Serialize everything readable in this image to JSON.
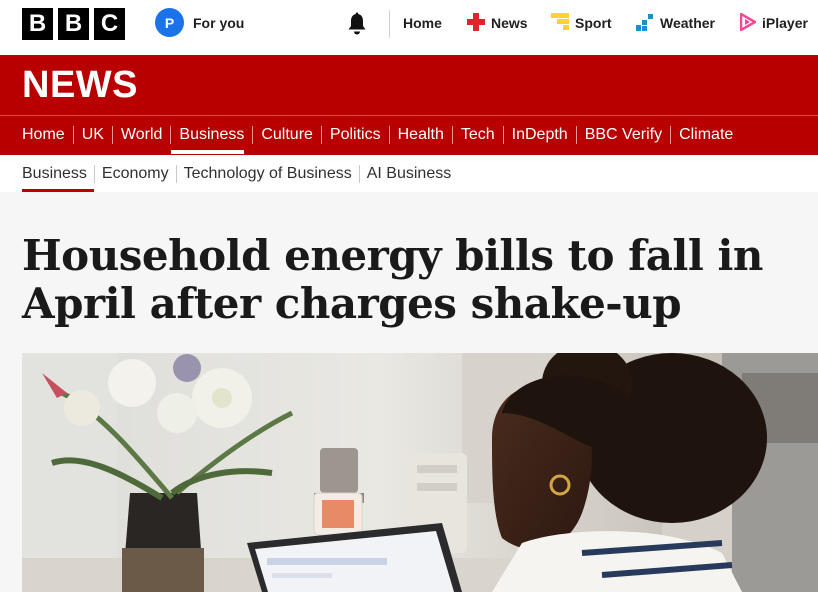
{
  "brand": {
    "letters": [
      "B",
      "B",
      "C"
    ]
  },
  "account": {
    "initial": "P",
    "label": "For you"
  },
  "top_nav": [
    {
      "label": "Home",
      "icon": "none"
    },
    {
      "label": "News",
      "icon": "news-icon"
    },
    {
      "label": "Sport",
      "icon": "sport-icon"
    },
    {
      "label": "Weather",
      "icon": "weather-icon"
    },
    {
      "label": "iPlayer",
      "icon": "iplayer-icon"
    }
  ],
  "section_title": "NEWS",
  "main_nav": [
    "Home",
    "UK",
    "World",
    "Business",
    "Culture",
    "Politics",
    "Health",
    "Tech",
    "InDepth",
    "BBC Verify",
    "Climate"
  ],
  "main_nav_active": "Business",
  "sub_nav": [
    "Business",
    "Economy",
    "Technology of Business",
    "AI Business"
  ],
  "sub_nav_active": "Business",
  "article": {
    "headline_line1": "Household energy bills to fall in",
    "headline_line2": "April after charges shake-up"
  },
  "colors": {
    "brand_red": "#b80000",
    "account_blue": "#1a73e8",
    "news_icon_red": "#e0242b",
    "sport_yellow": "#ffd230",
    "weather_blue": "#1a8fd1",
    "iplayer_pink": "#f54997"
  }
}
